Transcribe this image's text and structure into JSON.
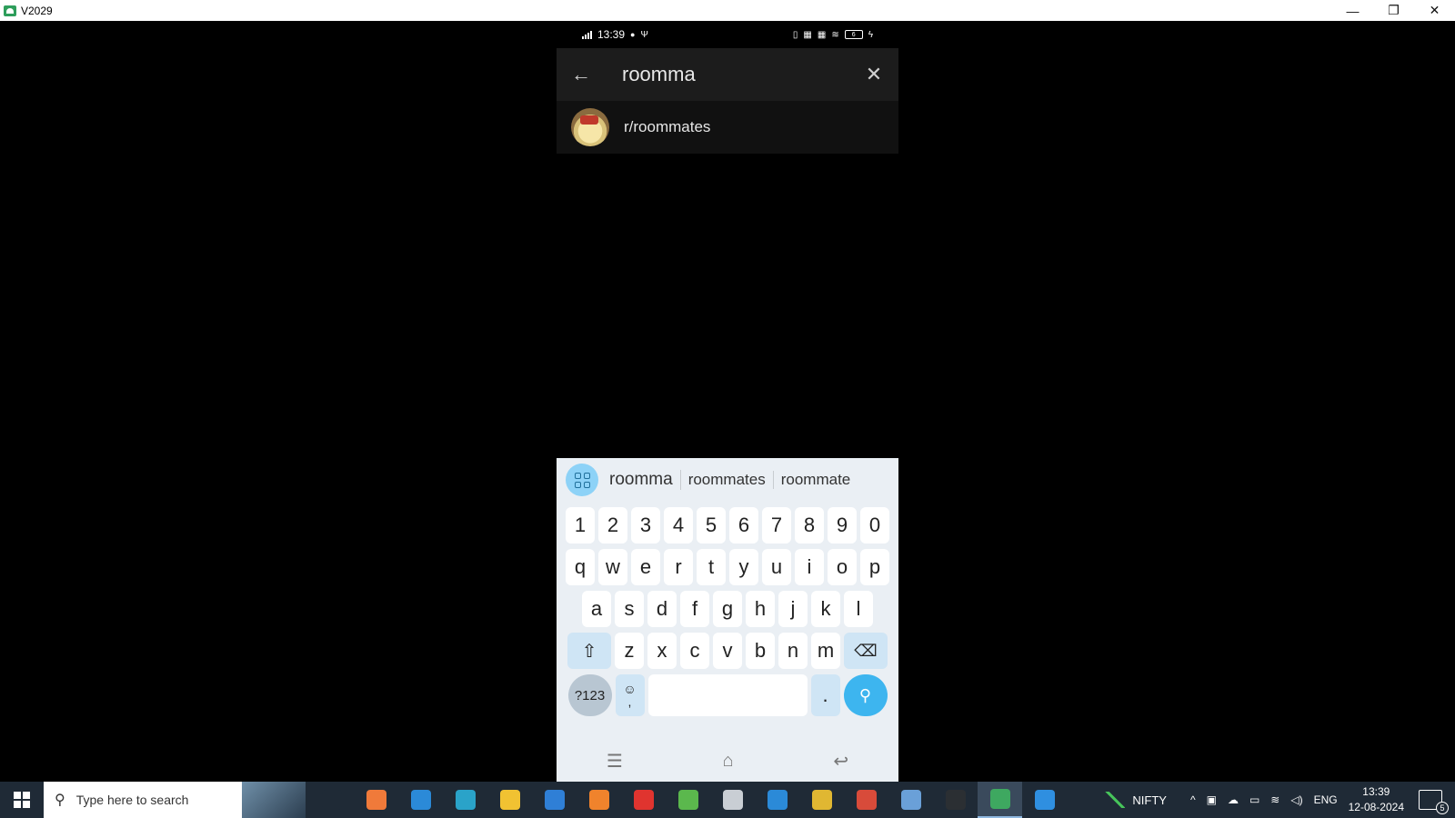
{
  "window": {
    "title": "V2029",
    "minimize": "—",
    "restore": "❐",
    "close": "✕"
  },
  "phone": {
    "status": {
      "time": "13:39",
      "battery": "6"
    },
    "search": {
      "query": "roomma",
      "back_icon": "←",
      "clear_icon": "✕"
    },
    "result": {
      "name": "r/roommates"
    },
    "keyboard": {
      "suggestions": [
        "roomma",
        "roommates",
        "roommate"
      ],
      "row_numbers": [
        "1",
        "2",
        "3",
        "4",
        "5",
        "6",
        "7",
        "8",
        "9",
        "0"
      ],
      "row1": [
        "q",
        "w",
        "e",
        "r",
        "t",
        "y",
        "u",
        "i",
        "o",
        "p"
      ],
      "row2": [
        "a",
        "s",
        "d",
        "f",
        "g",
        "h",
        "j",
        "k",
        "l"
      ],
      "row3": [
        "z",
        "x",
        "c",
        "v",
        "b",
        "n",
        "m"
      ],
      "sym_label": "?123",
      "dot_label": ".",
      "comma_label": ","
    }
  },
  "taskbar": {
    "search_placeholder": "Type here to search",
    "ticker": "NIFTY",
    "language": "ENG",
    "time": "13:39",
    "date": "12-08-2024",
    "notification_count": "5",
    "apps": [
      {
        "name": "task-view",
        "color": "#1f2a36"
      },
      {
        "name": "copilot",
        "color": "#f07a3a"
      },
      {
        "name": "store",
        "color": "#2b8ad8"
      },
      {
        "name": "edge",
        "color": "#2aa3c9"
      },
      {
        "name": "file-explorer",
        "color": "#f1c232"
      },
      {
        "name": "mail",
        "color": "#2f7fd6"
      },
      {
        "name": "firefox",
        "color": "#f0832c"
      },
      {
        "name": "wps",
        "color": "#e0342f"
      },
      {
        "name": "chat",
        "color": "#5bb84d"
      },
      {
        "name": "settings",
        "color": "#c9ced4"
      },
      {
        "name": "vscode",
        "color": "#2b8ad8"
      },
      {
        "name": "chrome",
        "color": "#e0b732"
      },
      {
        "name": "chrome-profile",
        "color": "#d84b3a"
      },
      {
        "name": "notepad",
        "color": "#6aa0d8"
      },
      {
        "name": "terminal",
        "color": "#2b2f33"
      },
      {
        "name": "scrcpy",
        "color": "#3ea860"
      },
      {
        "name": "photos",
        "color": "#2f8fe0"
      }
    ]
  }
}
